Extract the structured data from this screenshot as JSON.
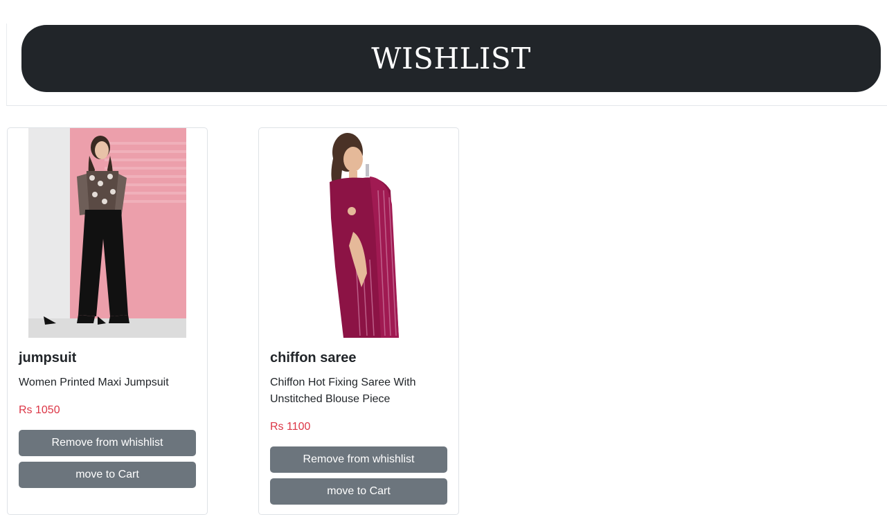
{
  "header": {
    "title": "WISHLIST"
  },
  "items": [
    {
      "name": "jumpsuit",
      "description": "Women Printed Maxi Jumpsuit",
      "price": "Rs 1050",
      "remove_label": "Remove from whishlist",
      "cart_label": "move to Cart"
    },
    {
      "name": "chiffon saree",
      "description": "Chiffon Hot Fixing Saree With Unstitched Blouse Piece",
      "price": "Rs 1100",
      "remove_label": "Remove from whishlist",
      "cart_label": "move to Cart"
    }
  ],
  "colors": {
    "banner_bg": "#212529",
    "price": "#dc3545",
    "button_bg": "#6c757d"
  }
}
